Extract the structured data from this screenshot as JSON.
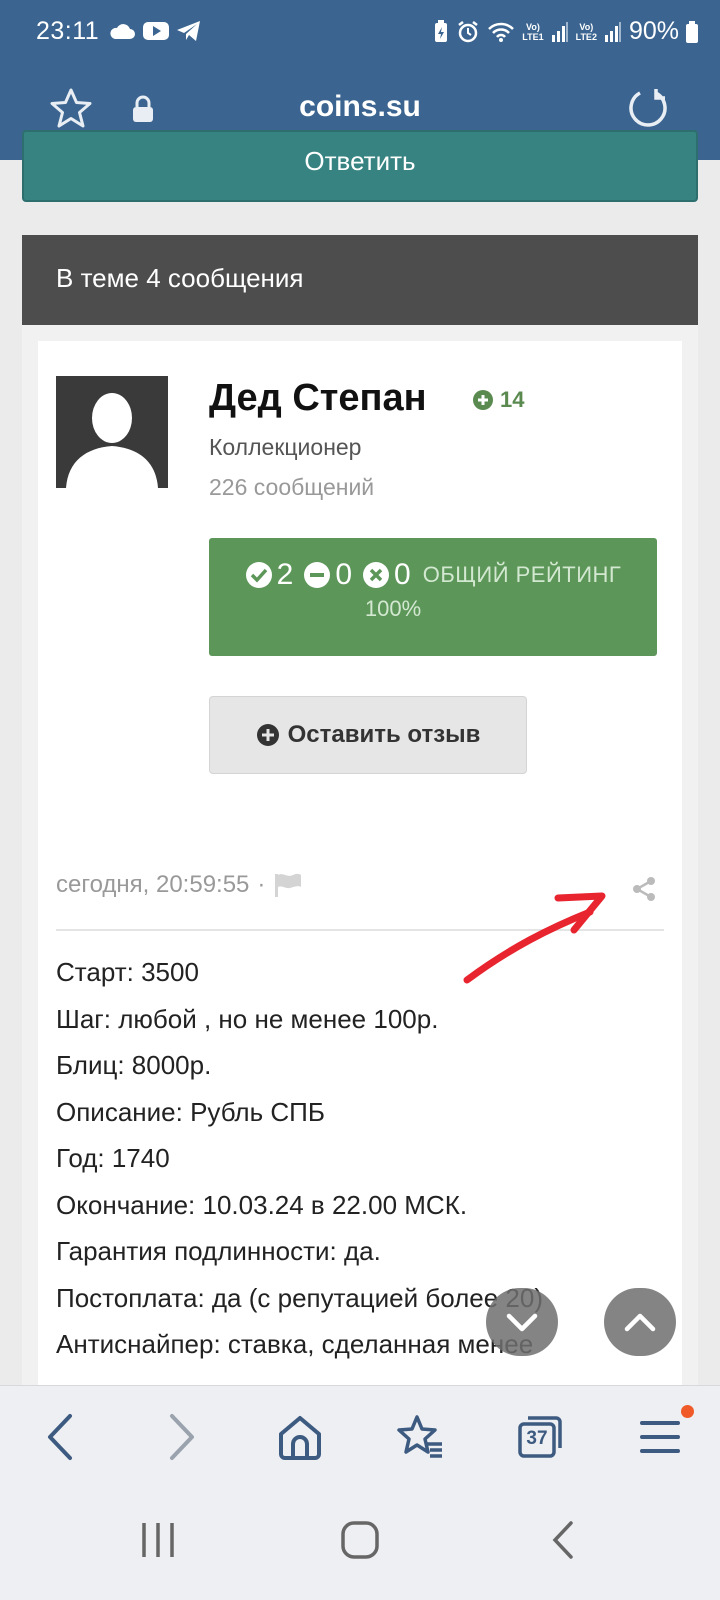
{
  "status_bar": {
    "time": "23:11",
    "battery": "90%"
  },
  "browser": {
    "url": "coins.su"
  },
  "page": {
    "answer_button": "Ответить",
    "topic_header": "В теме 4 сообщения",
    "post": {
      "author": "Дед Степан",
      "reputation": "14",
      "role": "Коллекционер",
      "post_count": "226 сообщений",
      "rating": {
        "positive": "2",
        "neutral": "0",
        "negative": "0",
        "label": "ОБЩИЙ РЕЙТИНГ",
        "percent": "100%"
      },
      "review_button": "Оставить отзыв",
      "timestamp": "сегодня, 20:59:55",
      "body_lines": [
        "Старт: 3500",
        "Шаг: любой , но не менее 100р.",
        "Блиц: 8000р.",
        "Описание: Рубль СПБ",
        "Год: 1740",
        "Окончание: 10.03.24 в 22.00 МСК.",
        "Гарантия подлинности: да.",
        "Постоплата: да (с репутацией более 20)",
        "Антиснайпер: ставка, сделанная менее"
      ]
    }
  },
  "toolbar": {
    "tabs_count": "37"
  },
  "colors": {
    "header_blue": "#3b6590",
    "answer_teal": "#368382",
    "rating_green": "#5c9659",
    "annotation_red": "#e8252f"
  }
}
